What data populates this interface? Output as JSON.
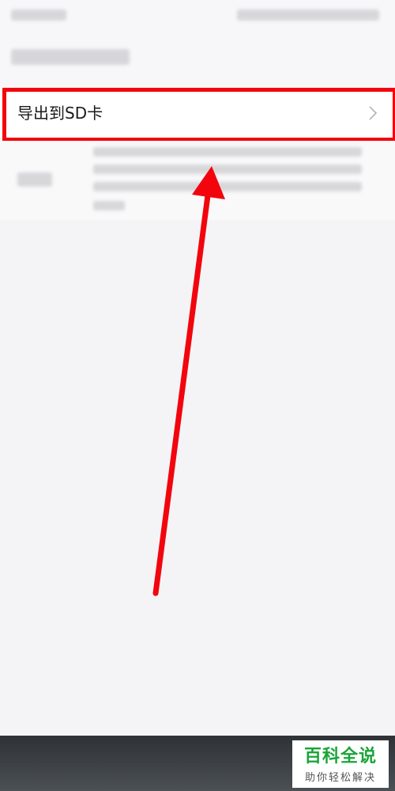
{
  "list": {
    "export_item_label": "导出到SD卡"
  },
  "icons": {
    "chevron": "chevron-right-icon",
    "annotation_arrow": "red-arrow-icon"
  },
  "watermark": {
    "title": "百科全说",
    "subtitle": "助你轻松解决"
  },
  "colors": {
    "highlight": "#f2050d",
    "watermark_green": "#19a538"
  }
}
